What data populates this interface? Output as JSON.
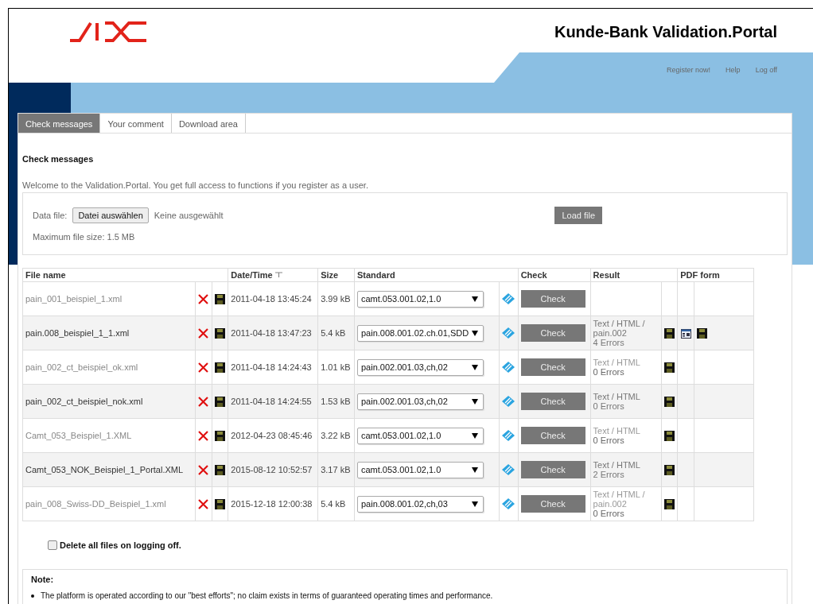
{
  "header": {
    "title": "Kunde-Bank Validation.Portal",
    "links": [
      "Register now!",
      "Help",
      "Log off"
    ]
  },
  "tabs": [
    {
      "label": "Check messages",
      "selected": true
    },
    {
      "label": "Your comment",
      "selected": false
    },
    {
      "label": "Download area",
      "selected": false
    }
  ],
  "heading": "Check messages",
  "welcome": "Welcome to the Validation.Portal. You get full access to functions if you register as a user.",
  "upload": {
    "label": "Data file:",
    "choose_button": "Datei auswählen",
    "file_status": "Keine ausgewählt",
    "load_button": "Load file",
    "max_size": "Maximum file size: 1.5 MB"
  },
  "table": {
    "columns": [
      "File name",
      "Date/Time",
      "Size",
      "Standard",
      "Check",
      "Result",
      "PDF form"
    ],
    "rows": [
      {
        "shaded": false,
        "file": "pain_001_beispiel_1.xml",
        "datetime": "2011-04-18 13:45:24",
        "size": "3.99 kB",
        "standard": "camt.053.001.02,1.0",
        "check": "Check",
        "result": [],
        "result_file": false,
        "pdf_form": false
      },
      {
        "shaded": true,
        "file": "pain.008_beispiel_1_1.xml",
        "datetime": "2011-04-18 13:47:23",
        "size": "5.4 kB",
        "standard": "pain.008.001.02.ch.01,SDD",
        "check": "Check",
        "result": [
          "Text / HTML /",
          "pain.002",
          "4 Errors"
        ],
        "result_file": true,
        "pdf_form": true
      },
      {
        "shaded": false,
        "file": "pain_002_ct_beispiel_ok.xml",
        "datetime": "2011-04-18 14:24:43",
        "size": "1.01 kB",
        "standard": "pain.002.001.03,ch,02",
        "check": "Check",
        "result": [
          "Text / HTML",
          "0 Errors"
        ],
        "result_file": true,
        "pdf_form": false
      },
      {
        "shaded": true,
        "file": "pain_002_ct_beispiel_nok.xml",
        "datetime": "2011-04-18 14:24:55",
        "size": "1.53 kB",
        "standard": "pain.002.001.03,ch,02",
        "check": "Check",
        "result": [
          "Text / HTML",
          "0 Errors"
        ],
        "result_file": true,
        "pdf_form": false
      },
      {
        "shaded": false,
        "file": "Camt_053_Beispiel_1.XML",
        "datetime": "2012-04-23 08:45:46",
        "size": "3.22 kB",
        "standard": "camt.053.001.02,1.0",
        "check": "Check",
        "result": [
          "Text / HTML",
          "0 Errors"
        ],
        "result_file": true,
        "pdf_form": false
      },
      {
        "shaded": true,
        "file": "Camt_053_NOK_Beispiel_1_Portal.XML",
        "datetime": "2015-08-12 10:52:57",
        "size": "3.17 kB",
        "standard": "camt.053.001.02,1.0",
        "check": "Check",
        "result": [
          "Text / HTML",
          "2 Errors"
        ],
        "result_file": true,
        "pdf_form": false
      },
      {
        "shaded": false,
        "file": "pain_008_Swiss-DD_Beispiel_1.xml",
        "datetime": "2015-12-18 12:00:38",
        "size": "5.4 kB",
        "standard": "pain.008.001.02,ch,03",
        "check": "Check",
        "result": [
          "Text / HTML /",
          "pain.002",
          "0 Errors"
        ],
        "result_file": true,
        "pdf_form": false
      }
    ]
  },
  "delete_on_logoff": {
    "label": "Delete all files on logging off.",
    "checked": false
  },
  "note": {
    "title": "Note:",
    "items": [
      "The platform is operated according to our \"best efforts\"; no claim exists in terms of guaranteed operating times and performance."
    ]
  }
}
